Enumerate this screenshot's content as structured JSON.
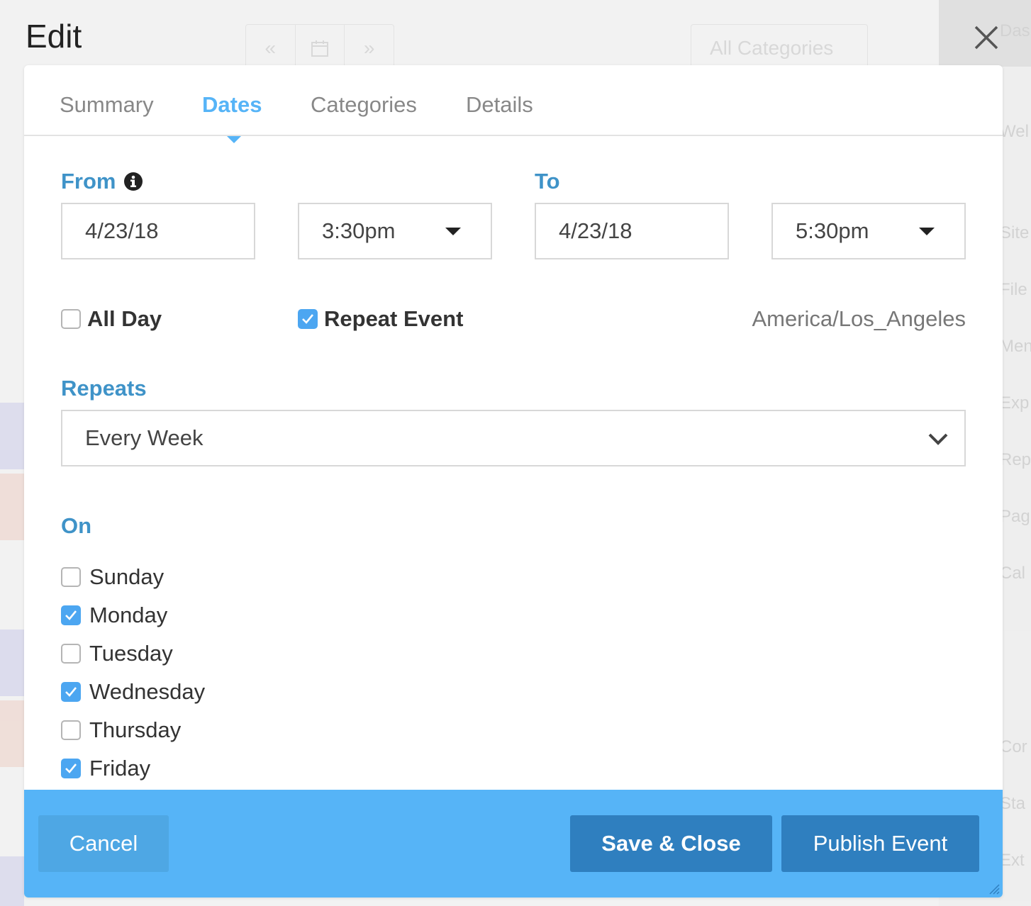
{
  "dialog": {
    "title": "Edit",
    "close_icon": "close-icon"
  },
  "background": {
    "categories_label": "All Categories",
    "nav_prev": "«",
    "nav_next": "»",
    "sidebar_items": [
      "Das",
      "Wel",
      "Site",
      "File",
      "Men",
      "Exp",
      "Rep",
      "Pag",
      "Cal",
      "Cor",
      "Sta",
      "Ext"
    ]
  },
  "tabs": [
    {
      "label": "Summary",
      "active": false
    },
    {
      "label": "Dates",
      "active": true
    },
    {
      "label": "Categories",
      "active": false
    },
    {
      "label": "Details",
      "active": false
    }
  ],
  "dates": {
    "from_label": "From",
    "to_label": "To",
    "from_date": "4/23/18",
    "from_time": "3:30pm",
    "to_date": "4/23/18",
    "to_time": "5:30pm",
    "all_day_label": "All Day",
    "all_day_checked": false,
    "repeat_label": "Repeat Event",
    "repeat_checked": true,
    "timezone": "America/Los_Angeles"
  },
  "repeats": {
    "label": "Repeats",
    "value": "Every Week"
  },
  "on": {
    "label": "On",
    "days": [
      {
        "label": "Sunday",
        "checked": false
      },
      {
        "label": "Monday",
        "checked": true
      },
      {
        "label": "Tuesday",
        "checked": false
      },
      {
        "label": "Wednesday",
        "checked": true
      },
      {
        "label": "Thursday",
        "checked": false
      },
      {
        "label": "Friday",
        "checked": true
      }
    ]
  },
  "footer": {
    "cancel_label": "Cancel",
    "save_label": "Save & Close",
    "publish_label": "Publish Event"
  },
  "colors": {
    "accent": "#56b4f7",
    "label_blue": "#3f93c8",
    "button_dark": "#2f7fbf"
  }
}
